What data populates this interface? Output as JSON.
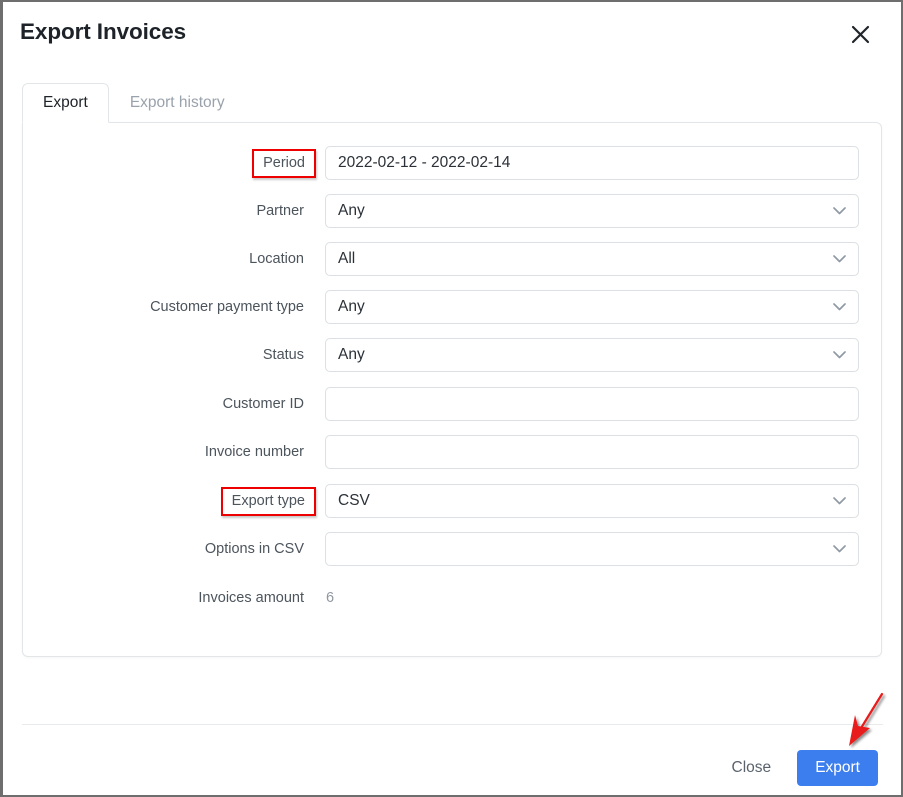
{
  "window": {
    "title": "Export Invoices",
    "close_icon": "close-icon"
  },
  "tabs": [
    {
      "label": "Export",
      "active": true
    },
    {
      "label": "Export history",
      "active": false
    }
  ],
  "form": {
    "fields": [
      {
        "label": "Period",
        "value": "2022-02-12 - 2022-02-14",
        "type": "text",
        "highlighted": true
      },
      {
        "label": "Partner",
        "value": "Any",
        "type": "select",
        "highlighted": false
      },
      {
        "label": "Location",
        "value": "All",
        "type": "select",
        "highlighted": false
      },
      {
        "label": "Customer payment type",
        "value": "Any",
        "type": "select",
        "highlighted": false
      },
      {
        "label": "Status",
        "value": "Any",
        "type": "select",
        "highlighted": false
      },
      {
        "label": "Customer ID",
        "value": "",
        "type": "text",
        "highlighted": false
      },
      {
        "label": "Invoice number",
        "value": "",
        "type": "text",
        "highlighted": false
      },
      {
        "label": "Export type",
        "value": "CSV",
        "type": "select",
        "highlighted": true
      },
      {
        "label": "Options in CSV",
        "value": "",
        "type": "select",
        "highlighted": false
      }
    ],
    "summary": {
      "label": "Invoices amount",
      "value": "6"
    }
  },
  "footer": {
    "close_label": "Close",
    "export_label": "Export"
  },
  "annotation": {
    "arrow_color": "#e81a1a",
    "highlight_color": "#ee0000",
    "target": "export-button"
  },
  "colors": {
    "primary_button": "#3d7eef",
    "title_text": "#1e2329",
    "label_text": "#4c545c",
    "muted_text": "#9aa2ac",
    "field_border": "#dcdfe3"
  }
}
